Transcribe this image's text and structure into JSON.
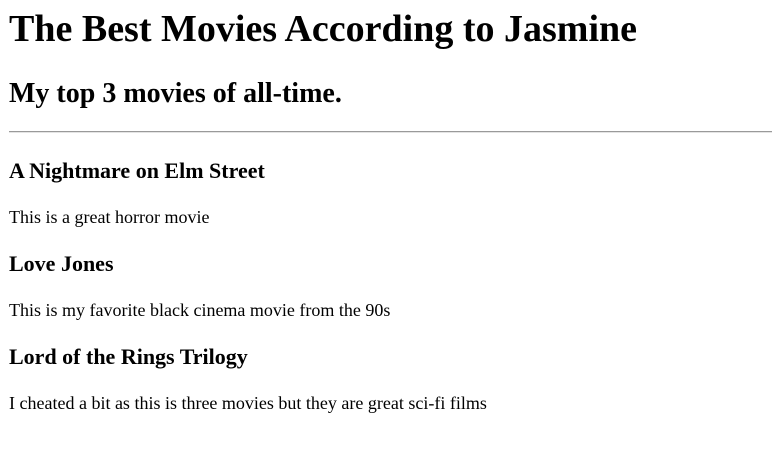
{
  "header": {
    "title": "The Best Movies According to Jasmine",
    "subtitle": "My top 3 movies of all-time."
  },
  "movies": [
    {
      "title": "A Nightmare on Elm Street",
      "description": "This is a great horror movie"
    },
    {
      "title": "Love Jones",
      "description": "This is my favorite black cinema movie from the 90s"
    },
    {
      "title": "Lord of the Rings Trilogy",
      "description": "I cheated a bit as this is three movies but they are great sci-fi films"
    }
  ]
}
